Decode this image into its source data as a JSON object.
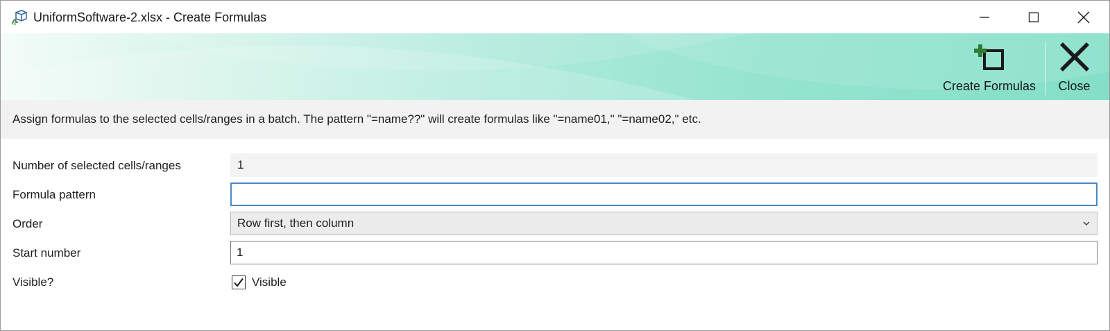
{
  "window": {
    "title": "UniformSoftware-2.xlsx - Create Formulas",
    "app_icon": "box-formula-icon",
    "controls": {
      "minimize": "minimize-icon",
      "maximize": "maximize-icon",
      "close": "close-icon"
    }
  },
  "ribbon": {
    "buttons": [
      {
        "label": "Create Formulas",
        "icon": "create-formulas-icon"
      },
      {
        "label": "Close",
        "icon": "close-x-icon"
      }
    ],
    "colors": {
      "gradient_start": "#f4fcf9",
      "gradient_end": "#84dfc8",
      "plus_icon": "#2e7d32"
    }
  },
  "description": "Assign formulas to the selected cells/ranges in a batch. The pattern \"=name??\" will create formulas like \"=name01,\" \"=name02,\" etc.",
  "form": {
    "selected_count": {
      "label": "Number of selected cells/ranges",
      "value": "1"
    },
    "formula_pattern": {
      "label": "Formula pattern",
      "value": "",
      "focused": true
    },
    "order": {
      "label": "Order",
      "value": "Row first, then column"
    },
    "start_number": {
      "label": "Start number",
      "value": "1"
    },
    "visible": {
      "label": "Visible?",
      "checkbox_label": "Visible",
      "checked": true
    }
  },
  "colors": {
    "focus_border": "#4a87c9",
    "description_bg": "#f2f2f2"
  }
}
